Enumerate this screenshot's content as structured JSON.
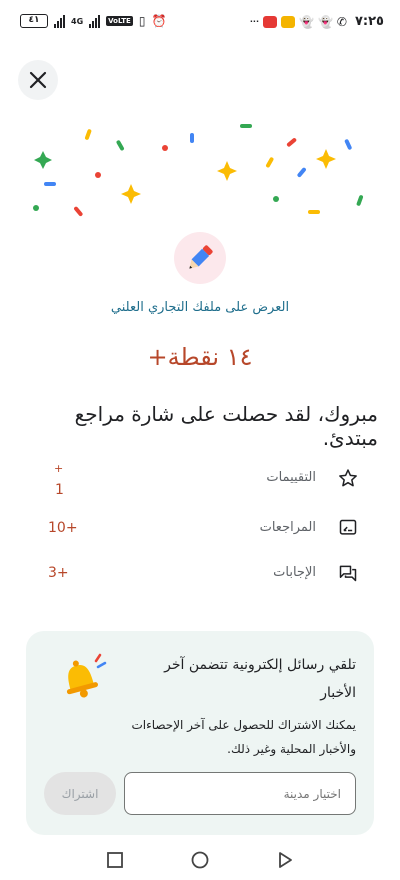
{
  "statusbar": {
    "battery": "٤١",
    "network": "4G",
    "volte": "VoLTE",
    "time": "٧:٢٥",
    "overflow": "···"
  },
  "header": {
    "close_icon": "close-icon"
  },
  "badge": {
    "icon": "pencil-icon",
    "profile_link": "العرض على ملفك التجاري العلني",
    "points": "+١٤ نقطة",
    "message": "مبروك، لقد حصلت على شارة مراجع مبتدئ."
  },
  "stats": [
    {
      "icon": "star-icon",
      "label": "التقييمات",
      "value_top": "+",
      "value": "1"
    },
    {
      "icon": "review-icon",
      "label": "المراجعات",
      "value": "10+"
    },
    {
      "icon": "answers-icon",
      "label": "الإجابات",
      "value": "3+"
    }
  ],
  "newsletter": {
    "title": "تلقي رسائل إلكترونية تتضمن آخر الأخبار",
    "description": "يمكنك الاشتراك للحصول على آخر الإحصاءات والأخبار المحلية وغير ذلك.",
    "city_placeholder": "اختيار مدينة",
    "subscribe_label": "اشتراك"
  },
  "colors": {
    "accent": "#b7472a",
    "link": "#1f6e8c",
    "card_bg": "#eef5f3"
  }
}
